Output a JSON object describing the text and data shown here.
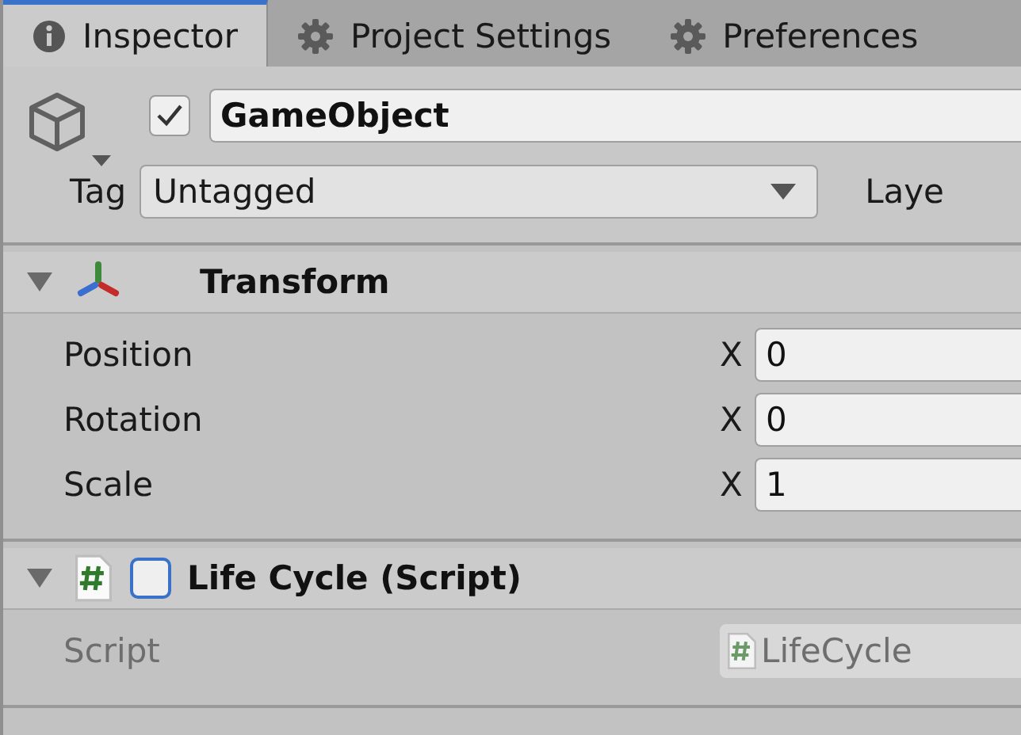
{
  "tabs": [
    {
      "label": "Inspector",
      "kind": "info",
      "selected": true
    },
    {
      "label": "Project Settings",
      "kind": "gear",
      "selected": false
    },
    {
      "label": "Preferences",
      "kind": "gear",
      "selected": false
    }
  ],
  "object": {
    "active": true,
    "name": "GameObject",
    "tag_label": "Tag",
    "tag": "Untagged",
    "layer_label": "Laye"
  },
  "components": [
    {
      "kind": "transform",
      "title": "Transform",
      "expanded": true,
      "properties": [
        {
          "label": "Position",
          "axis": "X",
          "value": "0"
        },
        {
          "label": "Rotation",
          "axis": "X",
          "value": "0"
        },
        {
          "label": "Scale",
          "axis": "X",
          "value": "1"
        }
      ]
    },
    {
      "kind": "script",
      "title": "Life Cycle (Script)",
      "expanded": true,
      "enabled": false,
      "properties": [
        {
          "label": "Script",
          "kind": "object",
          "value": "LifeCycle",
          "disabled": true
        }
      ]
    }
  ]
}
